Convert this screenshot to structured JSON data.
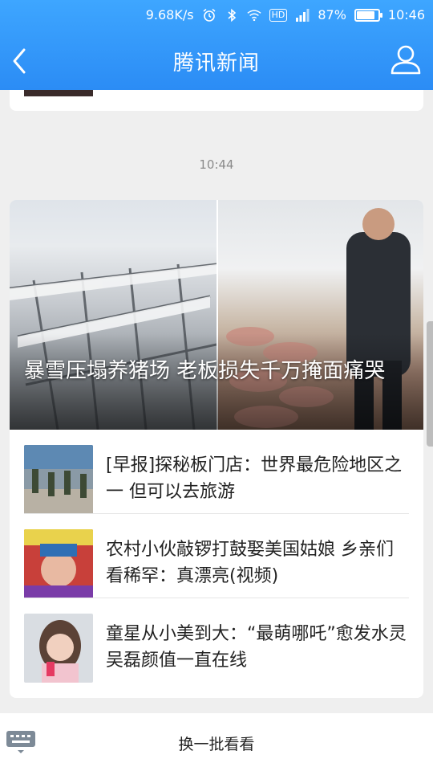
{
  "status": {
    "speed": "9.68K/s",
    "hd": "HD",
    "battery": "87%",
    "battery_level": 0.87,
    "time": "10:46"
  },
  "header": {
    "title": "腾讯新闻",
    "back_icon": "chevron-left-icon",
    "user_icon": "user-icon"
  },
  "timestamp": "10:44",
  "card": {
    "hero_title": "暴雪压塌养猪场 老板损失千万掩面痛哭",
    "items": [
      {
        "title": "[早报]探秘板门店：世界最危险地区之一 但可以去旅游"
      },
      {
        "title": "农村小伙敲锣打鼓娶美国姑娘 乡亲们看稀罕：真漂亮(视频)"
      },
      {
        "title": "童星从小美到大：“最萌哪吒”愈发水灵 吴磊颜值一直在线"
      }
    ]
  },
  "bottom": {
    "refresh_label": "换一批看看",
    "keyboard_icon": "keyboard-icon"
  },
  "colors": {
    "header_blue": "#2b8cf5",
    "background": "#efefef"
  }
}
